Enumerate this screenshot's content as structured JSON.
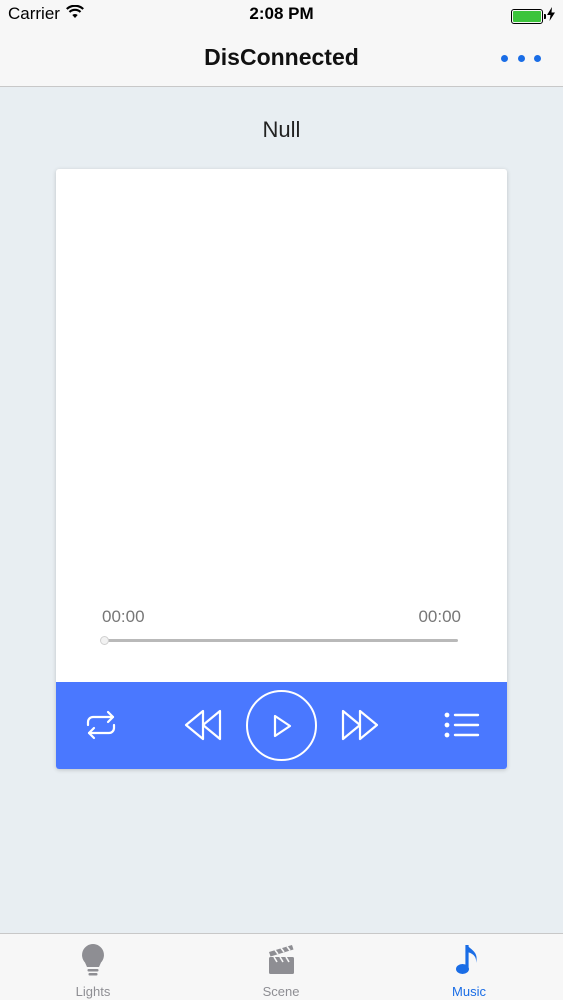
{
  "status_bar": {
    "carrier": "Carrier",
    "time": "2:08 PM",
    "battery_level": 1.0
  },
  "nav": {
    "title": "DisConnected",
    "more_icon": "more-horizontal-icon"
  },
  "player": {
    "song_title": "Null",
    "current_time": "00:00",
    "total_time": "00:00",
    "progress": 0,
    "controls": [
      "repeat-icon",
      "rewind-icon",
      "play-icon",
      "fast-forward-icon",
      "playlist-icon"
    ]
  },
  "tab_bar": {
    "tabs": [
      {
        "label": "Lights",
        "icon": "lightbulb-icon",
        "active": false
      },
      {
        "label": "Scene",
        "icon": "clapperboard-icon",
        "active": false
      },
      {
        "label": "Music",
        "icon": "music-note-icon",
        "active": true
      }
    ]
  },
  "colors": {
    "accent": "#1a6de6",
    "control_bar": "#4a78ff",
    "background": "#e8eef2",
    "battery": "#3cc43c"
  }
}
